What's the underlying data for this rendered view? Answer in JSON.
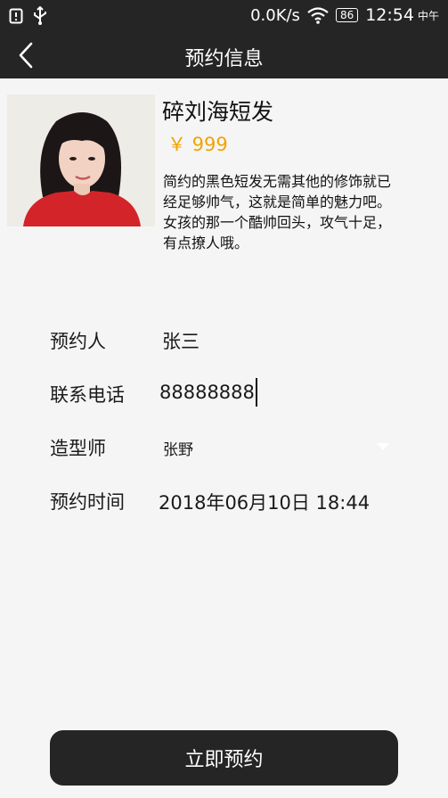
{
  "status_bar": {
    "network_speed": "0.0K/s",
    "battery": "86",
    "time": "12:54",
    "am_pm": "中午"
  },
  "nav": {
    "title": "预约信息"
  },
  "product": {
    "name": "碎刘海短发",
    "price": "￥ 999",
    "description": "简约的黑色短发无需其他的修饰就已经足够帅气，这就是简单的魅力吧。女孩的那一个酷帅回头，攻气十足，有点撩人哦。"
  },
  "form": {
    "name_label": "预约人",
    "name_value": "张三",
    "phone_label": "联系电话",
    "phone_value": "88888888",
    "stylist_label": "造型师",
    "stylist_value": "张野",
    "time_label": "预约时间",
    "time_value": "2018年06月10日 18:44"
  },
  "submit_label": "立即预约"
}
